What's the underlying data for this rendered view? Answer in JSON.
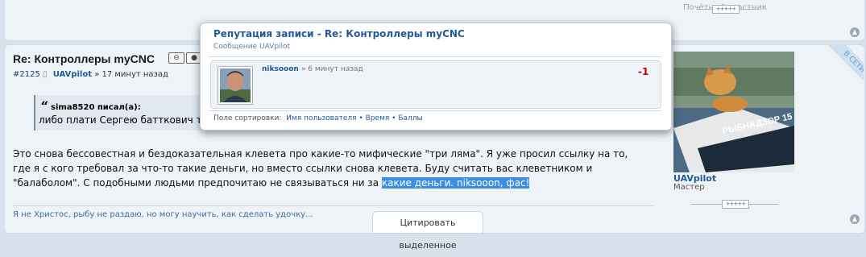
{
  "prev_post": {
    "rank": "Почётный участник",
    "reputation": "+++++"
  },
  "post": {
    "title": "Re: Контроллеры myCNC",
    "number": "#2125",
    "author": "UAVpilot",
    "time": "» 17 минут назад",
    "quote": {
      "author": "sima8520 писал(а):",
      "text": "либо плати Сергею батткович три"
    },
    "body_before": "Это снова бессовестная и бездоказательная клевета про какие-то мифические \"три ляма\". Я уже просил ссылку на то, где я с кого требовал за что-то такие деньги, но вместо ссылки снова клевета. Буду считать вас клеветником и \"балаболом\". С подобными людьми предпочитаю не связываться ни за ",
    "body_selected": "какие деньги. niksooon, фас!",
    "signature": "Я не Христос, рыбу не раздаю, но могу научить, как сделать удочку..."
  },
  "sidebar": {
    "online_ribbon": "В СЕТИ",
    "avatar_text": "РЫБНАДЗОР 15",
    "username": "UAVpilot",
    "rank": "Мастер",
    "reputation": "+++++"
  },
  "quote_selected_button": "Цитировать выделенное",
  "popup": {
    "title": "Репутация записи - Re: Контроллеры myCNC",
    "subtitle": "Сообщение UAVpilot",
    "entries": [
      {
        "user": "niksooon",
        "time": "» 6 минут назад",
        "score": "-1"
      }
    ],
    "sort_label": "Поле сортировки:",
    "sort_options": [
      "Имя пользователя",
      "Время",
      "Баллы"
    ]
  },
  "colors": {
    "link": "#1f5a96",
    "negative": "#bb0000",
    "selection": "#3d8ee0",
    "panel": "#eef3f8"
  }
}
